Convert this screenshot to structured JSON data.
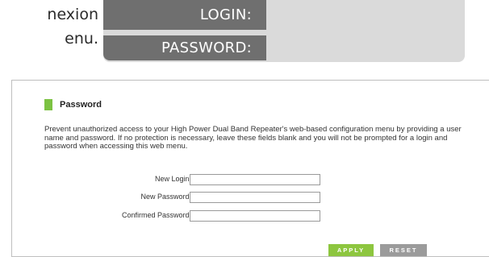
{
  "doc": {
    "line1": "nexion",
    "line2": "enu."
  },
  "credentials_graphic": {
    "login_label": "LOGIN:",
    "password_label": "PASSWORD:"
  },
  "web_page": {
    "section_title": "Password",
    "description": "Prevent unauthorized access to your High Power Dual Band Repeater's web-based configuration menu by providing a user name and password. If no protection is necessary, leave these fields blank and you will not be prompted for a login and password when accessing this web menu.",
    "fields": {
      "new_login": {
        "label": "New Login:",
        "value": ""
      },
      "new_password": {
        "label": "New Password:",
        "value": ""
      },
      "confirmed_password": {
        "label": "Confirmed Password:",
        "value": ""
      }
    },
    "buttons": {
      "apply": "APPLY",
      "reset": "RESET"
    }
  },
  "colors": {
    "accent_green": "#8dc63f",
    "label_gray": "#6f6f6f",
    "panel_gray": "#dadada"
  }
}
